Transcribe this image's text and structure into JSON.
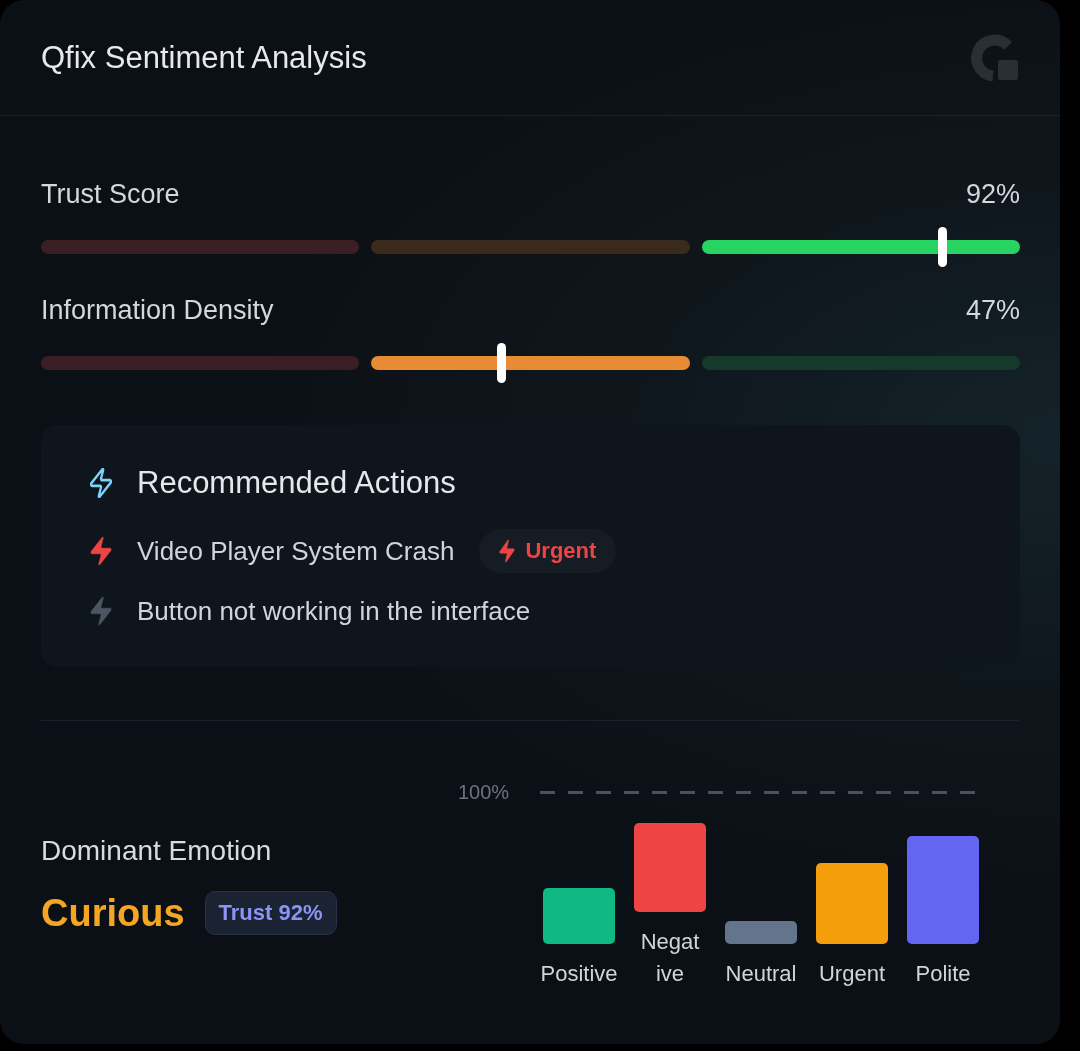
{
  "header": {
    "title": "Qfix Sentiment Analysis"
  },
  "meters": [
    {
      "label": "Trust Score",
      "reading": "92%",
      "level": 0.92
    },
    {
      "label": "Information Density",
      "reading": "47%",
      "level": 0.47
    }
  ],
  "recommended_actions": {
    "title": "Recommended Actions",
    "items": [
      {
        "text": "Video Player System Crash",
        "urgent": true,
        "badge": "Urgent"
      },
      {
        "text": "Button not working in the interface",
        "urgent": false
      }
    ]
  },
  "dominant_emotion": {
    "label": "Dominant Emotion",
    "emotion": "Curious",
    "badge": "Trust 92%"
  },
  "emotion_chart": {
    "reference_label": "100%",
    "bars": [
      {
        "label": "Positive",
        "color": "#10b981"
      },
      {
        "label": "Negat ive",
        "color": "#ef4444"
      },
      {
        "label": "Neutral",
        "color": "#64748b"
      },
      {
        "label": "Urgent",
        "color": "#f59e0b"
      },
      {
        "label": "Polite",
        "color": "#6366f1"
      }
    ]
  }
}
